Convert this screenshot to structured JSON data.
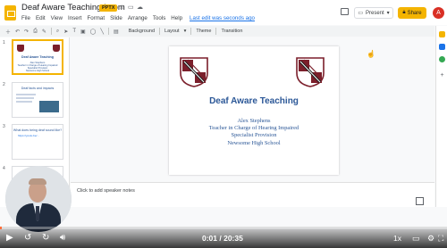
{
  "app": {
    "title": "Deaf Aware Teaching Loom",
    "badge": "PPTX",
    "last_edit": "Last edit was seconds ago",
    "menu": [
      "File",
      "Edit",
      "View",
      "Insert",
      "Format",
      "Slide",
      "Arrange",
      "Tools",
      "Help"
    ],
    "present_label": "Present",
    "share_label": "Share",
    "avatar_letter": "A",
    "accent_color": "#f4b400"
  },
  "toolbar": {
    "items": [
      "Background",
      "Layout",
      "Theme",
      "Transition"
    ]
  },
  "filmstrip": {
    "slides": [
      {
        "number": "1",
        "title": "Deaf Aware Teaching",
        "lines": [
          "Alex Stephens",
          "Teacher in Charge of Hearing Impaired",
          "Specialist Provision",
          "Newsome High School"
        ]
      },
      {
        "number": "2",
        "title": "Deaf facts and impacts"
      },
      {
        "number": "3",
        "title": "What does being deaf sound like?",
        "link": "https://youtu.be/..."
      },
      {
        "number": "4"
      }
    ]
  },
  "slide": {
    "title": "Deaf Aware Teaching",
    "lines": [
      "Alex Stephens",
      "Teacher in Charge of Hearing Impaired",
      "Specialist Provision",
      "Newsome High School"
    ]
  },
  "notes": {
    "placeholder": "Click to add speaker notes"
  },
  "player": {
    "current_time": "0:01",
    "total_time": "20:35",
    "time_display": "0:01 / 20:35",
    "speed": "1x",
    "progress": 0.001
  }
}
